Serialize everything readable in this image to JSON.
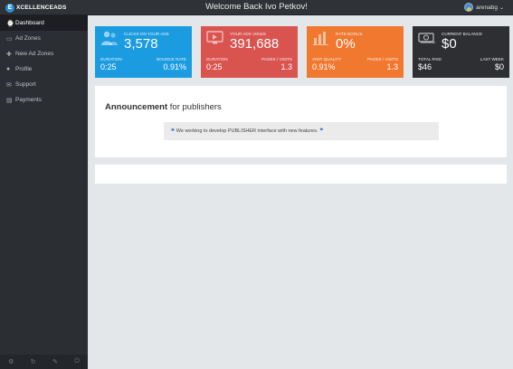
{
  "header": {
    "logo_badge": "E",
    "logo_text": "XCELLENCEADS",
    "welcome": "Welcome Back Ivo Petkov!",
    "username": "arenabg",
    "caret": "⌄"
  },
  "sidebar": {
    "items": [
      {
        "label": "Dashboard",
        "icon": "⌚"
      },
      {
        "label": "Ad Zones",
        "icon": "▭"
      },
      {
        "label": "New Ad Zones",
        "icon": "✚"
      },
      {
        "label": "Profile",
        "icon": "●"
      },
      {
        "label": "Support",
        "icon": "✉"
      },
      {
        "label": "Payments",
        "icon": "▤"
      }
    ],
    "footer_icons": [
      "⚙",
      "↻",
      "✎",
      "⏻"
    ]
  },
  "cards": [
    {
      "label": "CLICKS ON YOUR ADS",
      "value": "3,578",
      "sub_left_label": "DURATION",
      "sub_left_value": "0:25",
      "sub_right_label": "BOUNCE RATE",
      "sub_right_value": "0.91%",
      "color": "#1b9be0"
    },
    {
      "label": "YOUR ADS VIEWS",
      "value": "391,688",
      "sub_left_label": "DURATION",
      "sub_left_value": "0:25",
      "sub_right_label": "PAGES / VISITS",
      "sub_right_value": "1.3",
      "color": "#d9534f"
    },
    {
      "label": "RATE BONUS",
      "value": "0%",
      "sub_left_label": "VISIT QUALITY",
      "sub_left_value": "0.91%",
      "sub_right_label": "PAGES / VISITS",
      "sub_right_value": "1.3",
      "color": "#f0782f"
    },
    {
      "label": "CURRENT BALANCE",
      "value": "$0",
      "sub_left_label": "TOTAL PAID",
      "sub_left_value": "$46",
      "sub_right_label": "LAST WEEK",
      "sub_right_value": "$0",
      "color": "#2d2f33"
    }
  ],
  "announcement": {
    "title_bold": "Announcement",
    "title_rest": " for publishers",
    "open_quote": "❝",
    "message": "We working to develop PUBLISHER interface with new features.",
    "close_quote": "❞"
  }
}
